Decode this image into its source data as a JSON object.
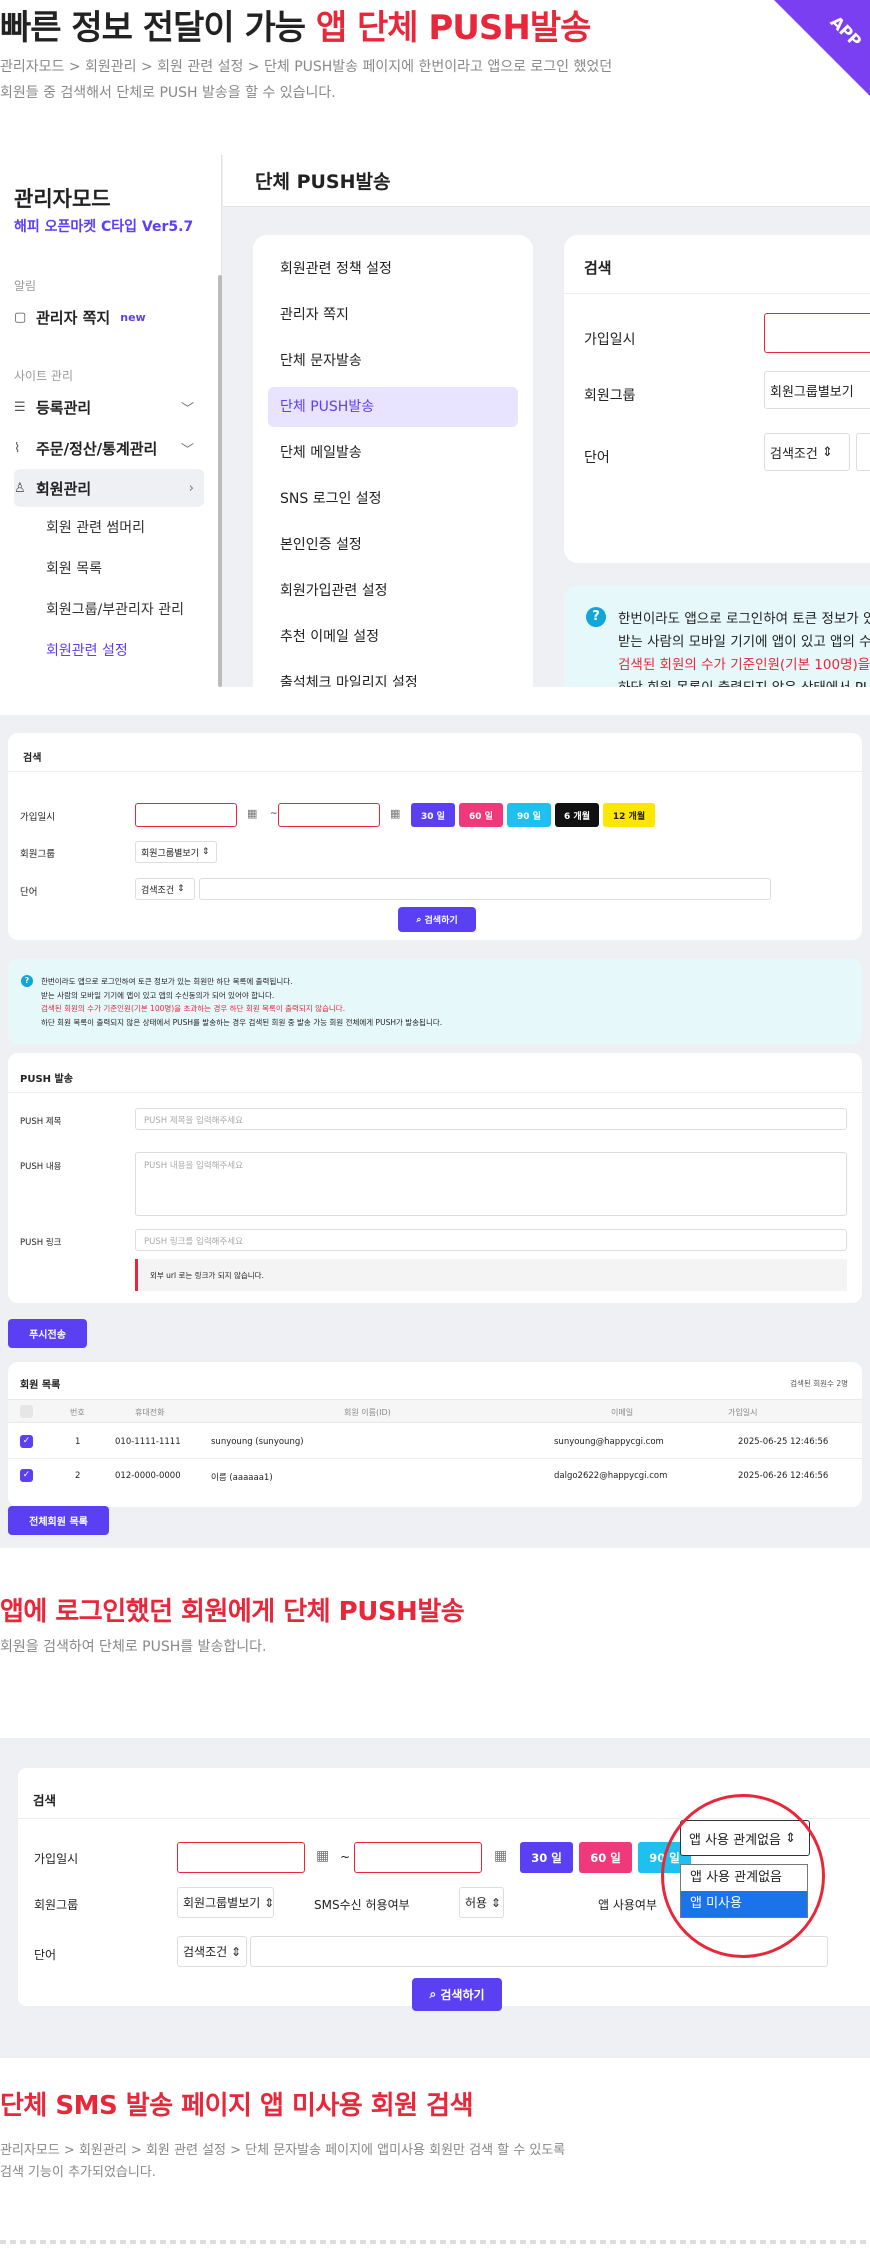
{
  "hero": {
    "title_plain": "빠른 정보 전달이 가능 ",
    "title_red": "앱 단체 PUSH발송",
    "desc1": "관리자모드 > 회원관리 > 회원 관련 설정 > 단체 PUSH발송 페이지에 한번이라고 앱으로 로그인 했었던",
    "desc2": "회원들 중 검색해서 단체로 PUSH 발송을 할 수 있습니다.",
    "ribbon": "APP"
  },
  "sidebar": {
    "brand": "관리자모드",
    "version": "해피 오픈마켓 C타입 Ver5.7",
    "sec_alert": "알림",
    "memo": "관리자 쪽지",
    "memo_badge": "new",
    "sec_site": "사이트 관리",
    "items": [
      "등록관리",
      "주문/정산/통계관리",
      "회원관리"
    ],
    "subitems": [
      "회원 관련 썸머리",
      "회원 목록",
      "회원그룹/부관리자 관리",
      "회원관련 설정"
    ]
  },
  "page_title": "단체 PUSH발송",
  "menu": [
    "회원관련 정책 설정",
    "관리자 쪽지",
    "단체 문자발송",
    "단체 PUSH발송",
    "단체 메일발송",
    "SNS 로그인 설정",
    "본인인증 설정",
    "회원가입관련 설정",
    "추천 이메일 설정",
    "출석체크 마일리지 설정"
  ],
  "search": {
    "title": "검색",
    "join_date": "가입일시",
    "group": "회원그룹",
    "word": "단어",
    "group_value": "회원그룹별보기",
    "cond_value": "검색조건",
    "tilde": "~",
    "periods": [
      "30 일",
      "60 일",
      "90 일",
      "6 개월",
      "12 개월"
    ],
    "button": "검색하기"
  },
  "info": {
    "lines": [
      "한번이라도 앱으로 로그인하여 토큰 정보가 있는 회원만 하단 목록에 출력됩니다.",
      "받는 사람의 모바일 기기에 앱이 있고 앱의 수신동의가 되어 있어야 합니다.",
      "검색된 회원의 수가 기준인원(기본 100명)을 초과하는 경우 하단 회원 목록이 출력되지 않습니다.",
      "하단 회원 목록이 출력되지 않은 상태에서 PUSH를 발송하는 경우 검색된 회원 중 발송 가능 회원 전체에게 PUSH가 발송됩니다."
    ],
    "zoom_lines": [
      "한번이라도 앱으로 로그인하여 토큰 정보가 있",
      "받는 사람의 모바일 기기에 앱이 있고 앱의 수",
      "검색된 회원의 수가 기준인원(기본 100명)을",
      "하단 회원 목록이 출력되지 않은 상태에서 PU"
    ]
  },
  "push": {
    "title": "PUSH 발송",
    "subject_label": "PUSH 제목",
    "subject_ph": "PUSH 제목을 입력해주세요",
    "content_label": "PUSH 내용",
    "content_ph": "PUSH 내용을 입력해주세요",
    "link_label": "PUSH 링크",
    "link_ph": "PUSH 링크를 입력해주세요",
    "notice": "외부 url 로는 링크가 되지 않습니다.",
    "send_button": "푸시전송"
  },
  "members": {
    "title": "회원 목록",
    "count": "검색된 회원수 2명",
    "headers": [
      "번호",
      "휴대전화",
      "회원 이름(ID)",
      "이메일",
      "가입일시"
    ],
    "rows": [
      {
        "no": "1",
        "phone": "010-1111-1111",
        "name": "sunyoung (sunyoung)",
        "email": "sunyoung@happycgi.com",
        "date": "2025-06-25 12:46:56"
      },
      {
        "no": "2",
        "phone": "012-0000-0000",
        "name": "이름 (aaaaaa1)",
        "email": "dalgo2622@happycgi.com",
        "date": "2025-06-26 12:46:56"
      }
    ],
    "all_button": "전체회원 목록"
  },
  "section2": {
    "title": "앱에 로그인했던 회원에게 단체 PUSH발송",
    "desc": "회원을 검색하여 단체로 PUSH를 발송합니다."
  },
  "panel3": {
    "sms_label": "SMS수신 허용여부",
    "sms_value": "허용",
    "app_label": "앱 사용여부",
    "app_value": "앱 사용 관계없음",
    "options": [
      "앱 사용 관계없음",
      "앱 미사용"
    ]
  },
  "section3": {
    "title": "단체 SMS 발송 페이지 앱 미사용 회원 검색",
    "desc1": "관리자모드 > 회원관리 > 회원 관련 설정 > 단체 문자발송 페이지에 앱미사용 회원만 검색 할 수 있도록",
    "desc2": "검색 기능이 추가되었습니다."
  },
  "colors": {
    "accent": "#5b3ff2",
    "red": "#e8273a",
    "pink": "#f0397a",
    "cyan": "#1ec0f0",
    "black": "#111111",
    "yellow": "#ffe600"
  }
}
